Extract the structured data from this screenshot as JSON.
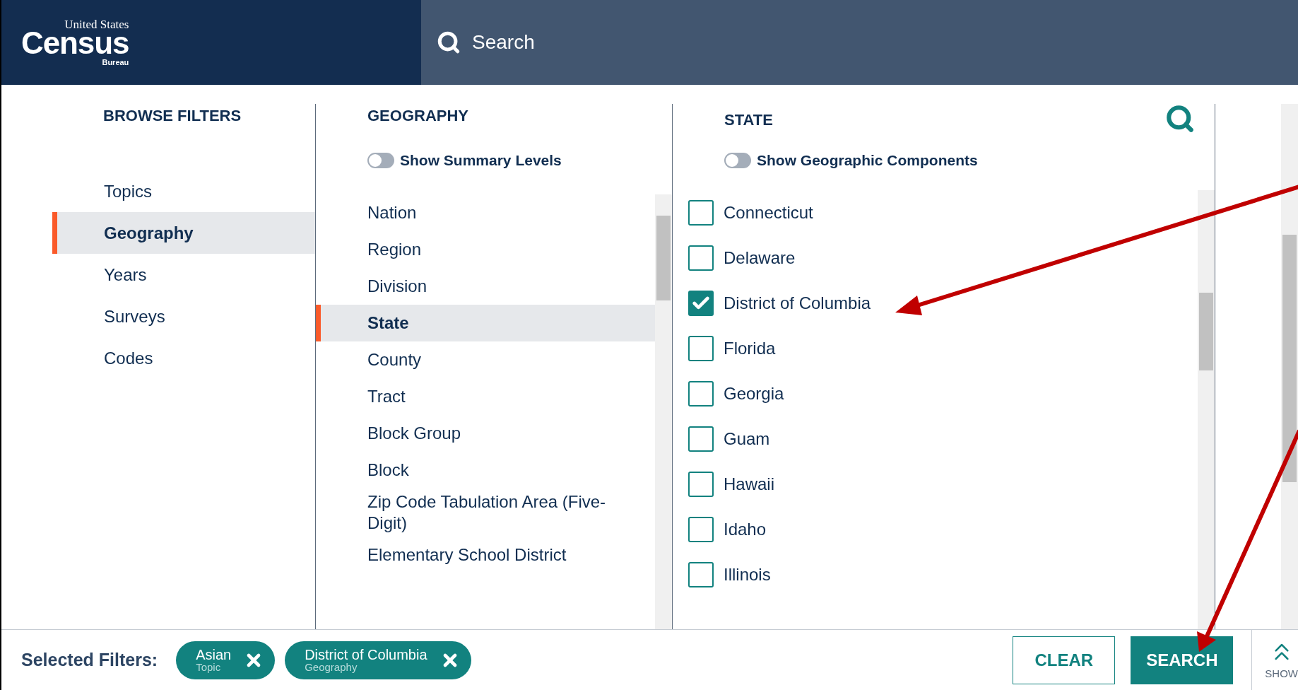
{
  "header": {
    "logo": {
      "top": "United States",
      "main": "Census",
      "bottom": "Bureau"
    },
    "search": {
      "placeholder": "Search"
    }
  },
  "browse": {
    "title": "BROWSE FILTERS",
    "items": [
      {
        "label": "Topics",
        "selected": false
      },
      {
        "label": "Geography",
        "selected": true
      },
      {
        "label": "Years",
        "selected": false
      },
      {
        "label": "Surveys",
        "selected": false
      },
      {
        "label": "Codes",
        "selected": false
      }
    ]
  },
  "geography": {
    "title": "GEOGRAPHY",
    "toggle": {
      "label": "Show Summary Levels",
      "on": false
    },
    "items": [
      {
        "label": "Nation",
        "selected": false
      },
      {
        "label": "Region",
        "selected": false
      },
      {
        "label": "Division",
        "selected": false
      },
      {
        "label": "State",
        "selected": true
      },
      {
        "label": "County",
        "selected": false
      },
      {
        "label": "Tract",
        "selected": false
      },
      {
        "label": "Block Group",
        "selected": false
      },
      {
        "label": "Block",
        "selected": false
      },
      {
        "label": "Zip Code Tabulation Area (Five-Digit)",
        "selected": false
      },
      {
        "label": "Elementary School District",
        "selected": false
      }
    ]
  },
  "state": {
    "title": "STATE",
    "toggle": {
      "label": "Show Geographic Components",
      "on": false
    },
    "items": [
      {
        "label": "Connecticut",
        "checked": false
      },
      {
        "label": "Delaware",
        "checked": false
      },
      {
        "label": "District of Columbia",
        "checked": true
      },
      {
        "label": "Florida",
        "checked": false
      },
      {
        "label": "Georgia",
        "checked": false
      },
      {
        "label": "Guam",
        "checked": false
      },
      {
        "label": "Hawaii",
        "checked": false
      },
      {
        "label": "Idaho",
        "checked": false
      },
      {
        "label": "Illinois",
        "checked": false
      }
    ]
  },
  "footer": {
    "label": "Selected Filters:",
    "chips": [
      {
        "label": "Asian",
        "sublabel": "Topic"
      },
      {
        "label": "District of Columbia",
        "sublabel": "Geography"
      }
    ],
    "buttons": [
      {
        "label": "CLEAR",
        "kind": "outline"
      },
      {
        "label": "SEARCH",
        "kind": "primary"
      }
    ],
    "show": "SHOW"
  }
}
